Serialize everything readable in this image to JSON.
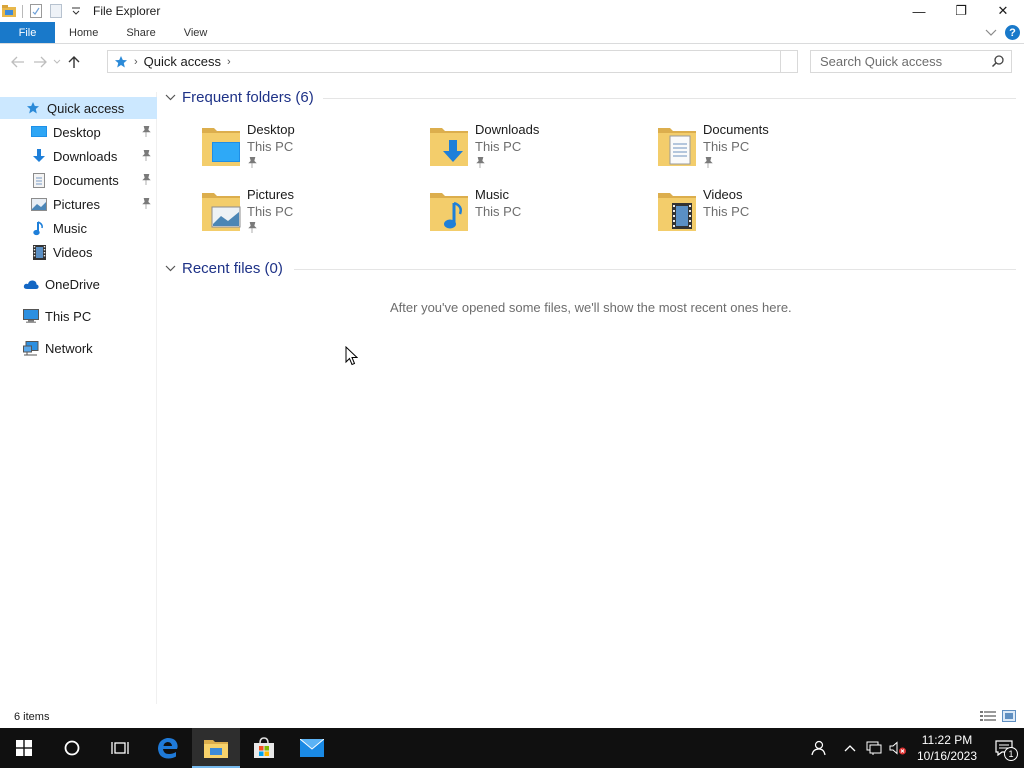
{
  "window": {
    "title": "File Explorer",
    "minimize_glyph": "—",
    "restore_glyph": "❐",
    "close_glyph": "✕"
  },
  "ribbon": {
    "tabs": [
      {
        "label": "File"
      },
      {
        "label": "Home"
      },
      {
        "label": "Share"
      },
      {
        "label": "View"
      }
    ],
    "help_glyph": "?"
  },
  "address": {
    "location": "Quick access",
    "search_placeholder": "Search Quick access"
  },
  "nav_pane": {
    "items": [
      {
        "label": "Quick access",
        "icon": "star-icon",
        "selected": true
      },
      {
        "label": "Desktop",
        "icon": "desktop-icon",
        "pinned": true
      },
      {
        "label": "Downloads",
        "icon": "download-icon",
        "pinned": true
      },
      {
        "label": "Documents",
        "icon": "document-icon",
        "pinned": true
      },
      {
        "label": "Pictures",
        "icon": "picture-icon",
        "pinned": true
      },
      {
        "label": "Music",
        "icon": "music-icon",
        "pinned": false
      },
      {
        "label": "Videos",
        "icon": "video-icon",
        "pinned": false
      },
      {
        "label": "OneDrive",
        "icon": "cloud-icon"
      },
      {
        "label": "This PC",
        "icon": "computer-icon"
      },
      {
        "label": "Network",
        "icon": "network-icon"
      }
    ]
  },
  "content": {
    "frequent_header": "Frequent folders (6)",
    "recent_header": "Recent files (0)",
    "empty_message": "After you've opened some files, we'll show the most recent ones here.",
    "folders": [
      {
        "name": "Desktop",
        "location": "This PC",
        "pinned": true
      },
      {
        "name": "Downloads",
        "location": "This PC",
        "pinned": true
      },
      {
        "name": "Documents",
        "location": "This PC",
        "pinned": true
      },
      {
        "name": "Pictures",
        "location": "This PC",
        "pinned": true
      },
      {
        "name": "Music",
        "location": "This PC",
        "pinned": false
      },
      {
        "name": "Videos",
        "location": "This PC",
        "pinned": false
      }
    ]
  },
  "status": {
    "item_count": "6 items"
  },
  "taskbar": {
    "time": "11:22 PM",
    "date": "10/16/2023",
    "notification_count": "1"
  },
  "colors": {
    "accent": "#1979ca",
    "selection": "#cce8ff",
    "header_text": "#1e3287",
    "taskbar": "#101010"
  }
}
